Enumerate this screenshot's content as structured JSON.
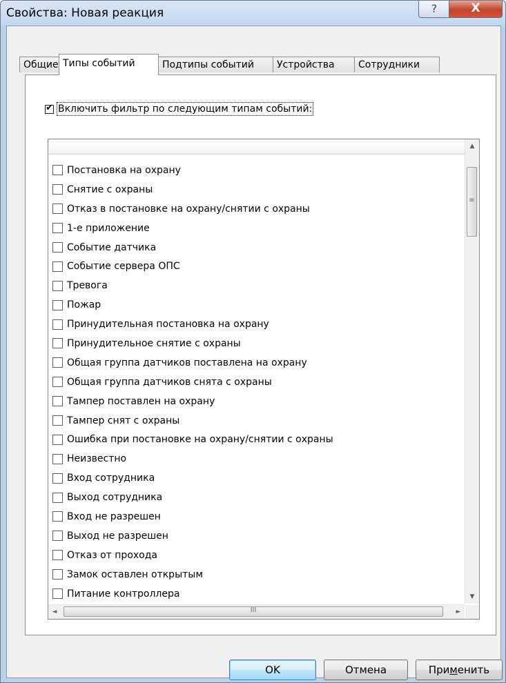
{
  "window": {
    "title": "Свойства: Новая реакция",
    "help_label": "?",
    "close_label": "X"
  },
  "tabs": [
    {
      "label": "Общие",
      "active": false
    },
    {
      "label": "Типы событий",
      "active": true
    },
    {
      "label": "Подтипы событий",
      "active": false
    },
    {
      "label": "Устройства",
      "active": false
    },
    {
      "label": "Сотрудники",
      "active": false
    }
  ],
  "filter": {
    "label": "Включить фильтр по следующим типам событий:",
    "checked": true
  },
  "event_types": [
    "Постановка на охрану",
    "Снятие с охраны",
    "Отказ в постановке на охрану/снятии с охраны",
    "1-е приложение",
    "Событие датчика",
    "Событие сервера ОПС",
    "Тревога",
    "Пожар",
    "Принудительная постановка на охрану",
    "Принудительное снятие с охраны",
    "Общая группа датчиков поставлена на охрану",
    "Общая группа датчиков снята с охраны",
    "Тампер поставлен на охрану",
    "Тампер снят с охраны",
    "Ошибка при постановке на охрану/снятии с охраны",
    "Неизвестно",
    "Вход сотрудника",
    "Выход сотрудника",
    "Вход не разрешен",
    "Выход не разрешен",
    "Отказ от прохода",
    "Замок оставлен открытым",
    "Питание контроллера"
  ],
  "scroll": {
    "vthumb_grip": "≡",
    "hthumb_grip": "III",
    "up": "▲",
    "down": "▼",
    "left": "◄",
    "right": "►"
  },
  "buttons": {
    "ok": "OK",
    "cancel": "Отмена",
    "apply_prefix": "При",
    "apply_mnemonic": "м",
    "apply_suffix": "енить"
  }
}
